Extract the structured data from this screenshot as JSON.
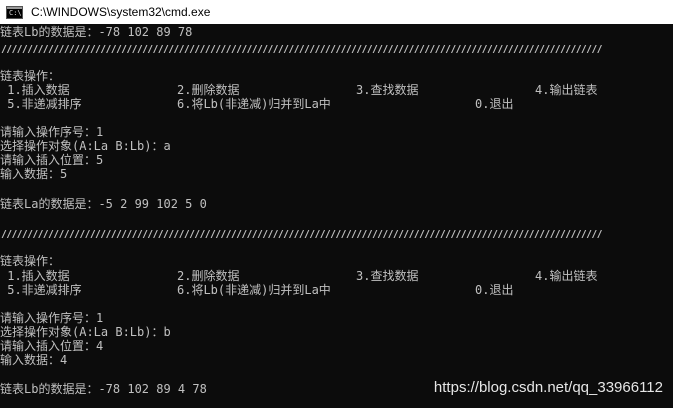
{
  "window": {
    "title": "C:\\WINDOWS\\system32\\cmd.exe",
    "icon_glyph": "C:\\"
  },
  "console": {
    "lines_top": {
      "lb_data_1": "链表Lb的数据是：-78 102 89 78",
      "separator": "///////////////////////////////////////////////////////////////////////////////////////////////////////////////////"
    },
    "menu_1": {
      "header": "链表操作：",
      "insert": " 1.插入数据",
      "delete": "2.删除数据",
      "find": "3.查找数据",
      "print": "4.输出链表",
      "sort": " 5.非递减排序",
      "merge": "6.将Lb(非递减)归并到La中",
      "exit": "0.退出"
    },
    "op_1": {
      "prompt_op": "请输入操作序号：1",
      "prompt_target": "选择操作对象(A:La B:Lb)：a",
      "prompt_pos": "请输入插入位置：5",
      "prompt_data": "输入数据：5",
      "result": "链表La的数据是：-5 2 99 102 5 0"
    },
    "menu_2": {
      "header": "链表操作：",
      "insert": " 1.插入数据",
      "delete": "2.删除数据",
      "find": "3.查找数据",
      "print": "4.输出链表",
      "sort": " 5.非递减排序",
      "merge": "6.将Lb(非递减)归并到La中",
      "exit": "0.退出"
    },
    "op_2": {
      "prompt_op": "请输入操作序号：1",
      "prompt_target": "选择操作对象(A:La B:Lb)：b",
      "prompt_pos": "请输入插入位置：4",
      "prompt_data": "输入数据：4",
      "result": "链表Lb的数据是：-78 102 89 4 78"
    }
  },
  "watermark": "https://blog.csdn.net/qq_33966112"
}
